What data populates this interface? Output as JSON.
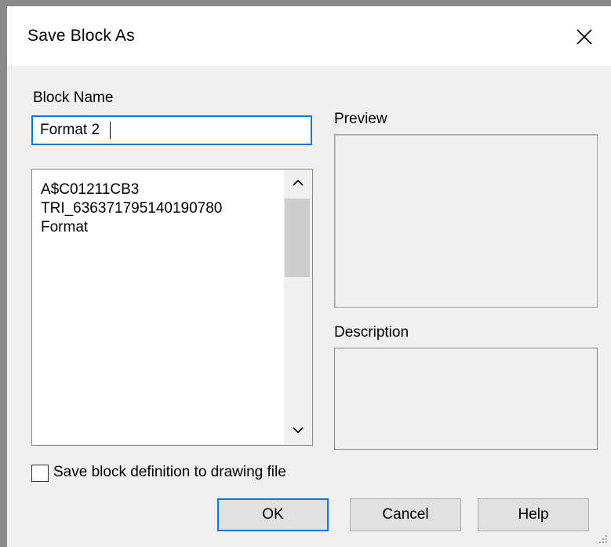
{
  "window": {
    "title": "Save Block As",
    "close_icon": "close-icon"
  },
  "form": {
    "block_name_label": "Block Name",
    "block_name_value": "Format 2",
    "preview_label": "Preview",
    "description_label": "Description",
    "description_value": ""
  },
  "block_list": {
    "items": [
      {
        "label": "A$C01211CB3"
      },
      {
        "label": "TRI_636371795140190780"
      },
      {
        "label": "Format"
      }
    ]
  },
  "options": {
    "save_definition_label": "Save block definition to drawing file",
    "save_definition_checked": false
  },
  "buttons": {
    "ok": "OK",
    "cancel": "Cancel",
    "help": "Help"
  },
  "colors": {
    "accent": "#0078d7",
    "dialog_background": "#f0f0f0",
    "button_face": "#e1e1e1"
  }
}
